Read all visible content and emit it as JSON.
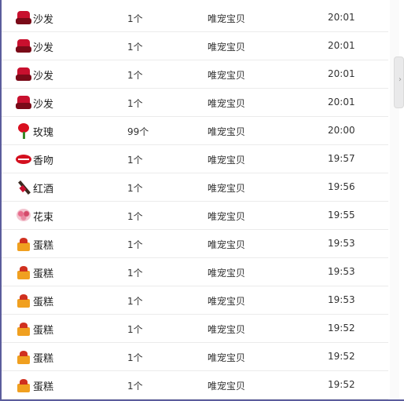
{
  "rows": [
    {
      "icon": "sofa-icon",
      "gift": "沙发",
      "qty": "1个",
      "from": "唯宠宝贝",
      "time": "20:01"
    },
    {
      "icon": "sofa-icon",
      "gift": "沙发",
      "qty": "1个",
      "from": "唯宠宝贝",
      "time": "20:01"
    },
    {
      "icon": "sofa-icon",
      "gift": "沙发",
      "qty": "1个",
      "from": "唯宠宝贝",
      "time": "20:01"
    },
    {
      "icon": "sofa-icon",
      "gift": "沙发",
      "qty": "1个",
      "from": "唯宠宝贝",
      "time": "20:01"
    },
    {
      "icon": "rose-icon",
      "gift": "玫瑰",
      "qty": "99个",
      "from": "唯宠宝贝",
      "time": "20:00"
    },
    {
      "icon": "kiss-icon",
      "gift": "香吻",
      "qty": "1个",
      "from": "唯宠宝贝",
      "time": "19:57"
    },
    {
      "icon": "wine-icon",
      "gift": "红酒",
      "qty": "1个",
      "from": "唯宠宝贝",
      "time": "19:56"
    },
    {
      "icon": "bouquet-icon",
      "gift": "花束",
      "qty": "1个",
      "from": "唯宠宝贝",
      "time": "19:55"
    },
    {
      "icon": "cake-icon",
      "gift": "蛋糕",
      "qty": "1个",
      "from": "唯宠宝贝",
      "time": "19:53"
    },
    {
      "icon": "cake-icon",
      "gift": "蛋糕",
      "qty": "1个",
      "from": "唯宠宝贝",
      "time": "19:53"
    },
    {
      "icon": "cake-icon",
      "gift": "蛋糕",
      "qty": "1个",
      "from": "唯宠宝贝",
      "time": "19:53"
    },
    {
      "icon": "cake-icon",
      "gift": "蛋糕",
      "qty": "1个",
      "from": "唯宠宝贝",
      "time": "19:52"
    },
    {
      "icon": "cake-icon",
      "gift": "蛋糕",
      "qty": "1个",
      "from": "唯宠宝贝",
      "time": "19:52"
    },
    {
      "icon": "cake-icon",
      "gift": "蛋糕",
      "qty": "1个",
      "from": "唯宠宝贝",
      "time": "19:52"
    }
  ],
  "scroll_arrow": "›",
  "colors": {
    "border": "#5b5d9c",
    "divider": "#ebebeb"
  }
}
